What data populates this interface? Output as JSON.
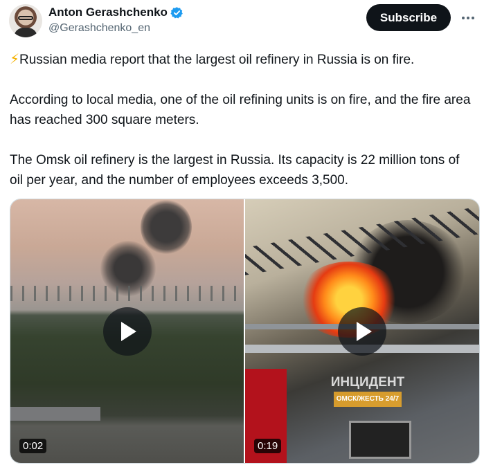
{
  "author": {
    "name": "Anton Gerashchenko",
    "handle": "@Gerashchenko_en",
    "verified": true,
    "verified_color": "#1d9bf0"
  },
  "actions": {
    "subscribe_label": "Subscribe",
    "more_icon": "more-horizontal-icon"
  },
  "tweet": {
    "emoji": "⚡",
    "paragraphs": [
      "Russian media report that the largest oil refinery in Russia is on fire.",
      "According to local media, one of the oil refining units is on fire, and the fire area has reached 300 square meters.",
      "The Omsk oil refinery is the largest in Russia. Its capacity is 22 million tons of oil per year, and the number of employees exceeds 3,500."
    ]
  },
  "media": {
    "videos": [
      {
        "duration": "0:02"
      },
      {
        "duration": "0:19",
        "watermark_title": "ИНЦИДЕНТ",
        "watermark_sub": "ОМСК/ЖЕСТЬ 24/7"
      }
    ]
  }
}
